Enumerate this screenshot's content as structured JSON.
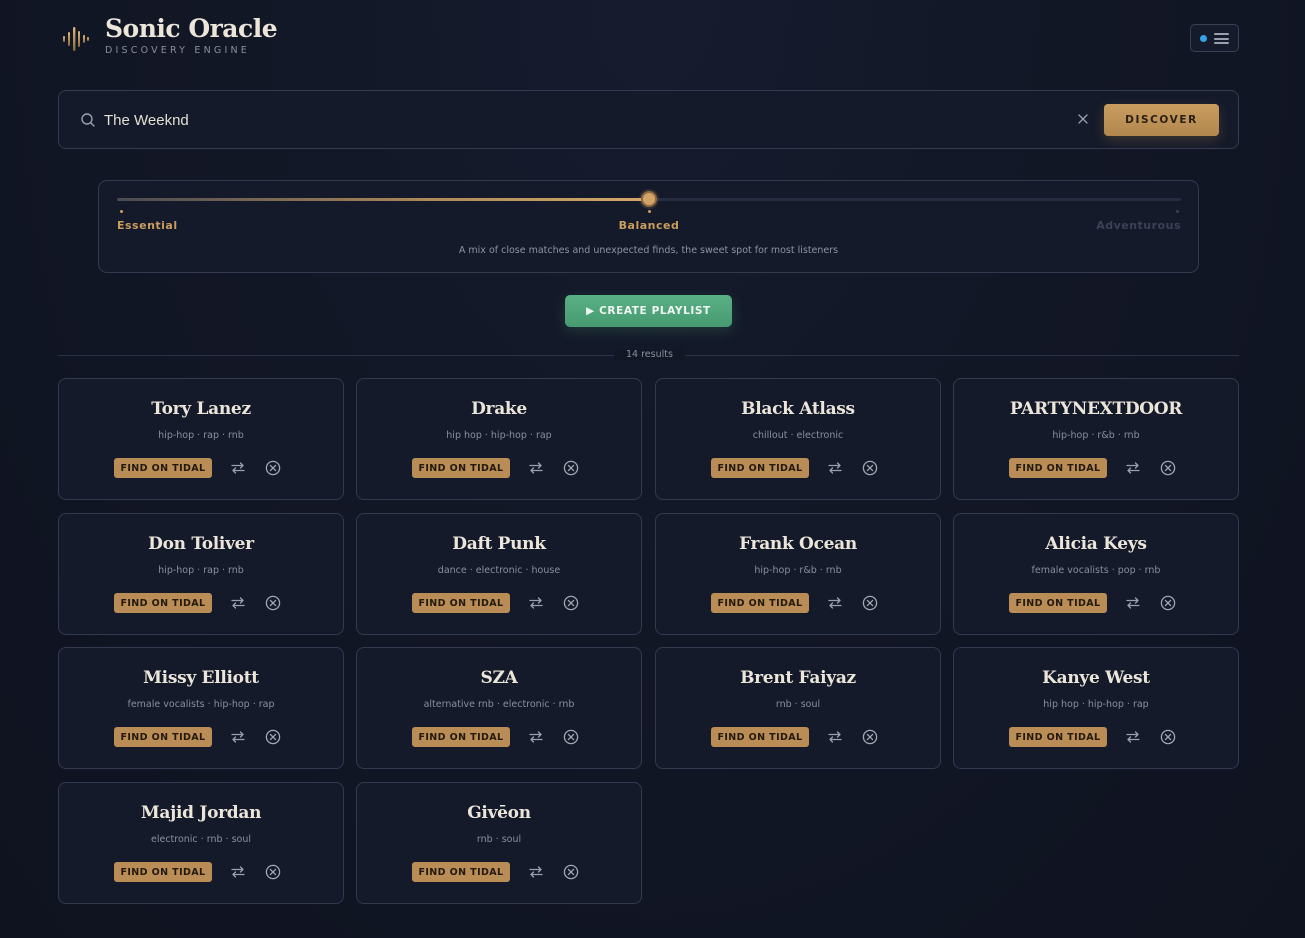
{
  "app": {
    "title": "Sonic Oracle",
    "subtitle": "DISCOVERY ENGINE",
    "logo_icon": "waveform-icon",
    "menu_icon": "hamburger-menu-icon",
    "status_dot_color": "#35a3e6"
  },
  "search": {
    "value": "The Weeknd",
    "search_icon": "search-icon",
    "clear_icon": "close-icon",
    "button_label": "DISCOVER"
  },
  "slider": {
    "stops": [
      "Essential",
      "Balanced",
      "Adventurous"
    ],
    "selected": "Balanced",
    "value": 0.5,
    "description": "A mix of close matches and unexpected finds, the sweet spot for most listeners"
  },
  "create_playlist": {
    "label": "▶ CREATE PLAYLIST"
  },
  "results": {
    "count_label": "14 results"
  },
  "card_actions": {
    "tidal_label": "FIND ON TIDAL",
    "swap_icon": "swap-arrows-icon",
    "remove_icon": "circle-x-icon"
  },
  "artists": [
    {
      "name": "Tory Lanez",
      "tags": "hip-hop · rap · rnb"
    },
    {
      "name": "Drake",
      "tags": "hip hop · hip-hop · rap"
    },
    {
      "name": "Black Atlass",
      "tags": "chillout · electronic"
    },
    {
      "name": "PARTYNEXTDOOR",
      "tags": "hip-hop · r&b · rnb"
    },
    {
      "name": "Don Toliver",
      "tags": "hip-hop · rap · rnb"
    },
    {
      "name": "Daft Punk",
      "tags": "dance · electronic · house"
    },
    {
      "name": "Frank Ocean",
      "tags": "hip-hop · r&b · rnb"
    },
    {
      "name": "Alicia Keys",
      "tags": "female vocalists · pop · rnb"
    },
    {
      "name": "Missy Elliott",
      "tags": "female vocalists · hip-hop · rap"
    },
    {
      "name": "SZA",
      "tags": "alternative rnb · electronic · rnb"
    },
    {
      "name": "Brent Faiyaz",
      "tags": "rnb · soul"
    },
    {
      "name": "Kanye West",
      "tags": "hip hop · hip-hop · rap"
    },
    {
      "name": "Majid Jordan",
      "tags": "electronic · rnb · soul"
    },
    {
      "name": "Givēon",
      "tags": "rnb · soul"
    }
  ],
  "colors": {
    "accent_gold": "#c99d5f",
    "accent_green": "#52a77b",
    "background": "#121726",
    "card_background": "#141a2a"
  }
}
